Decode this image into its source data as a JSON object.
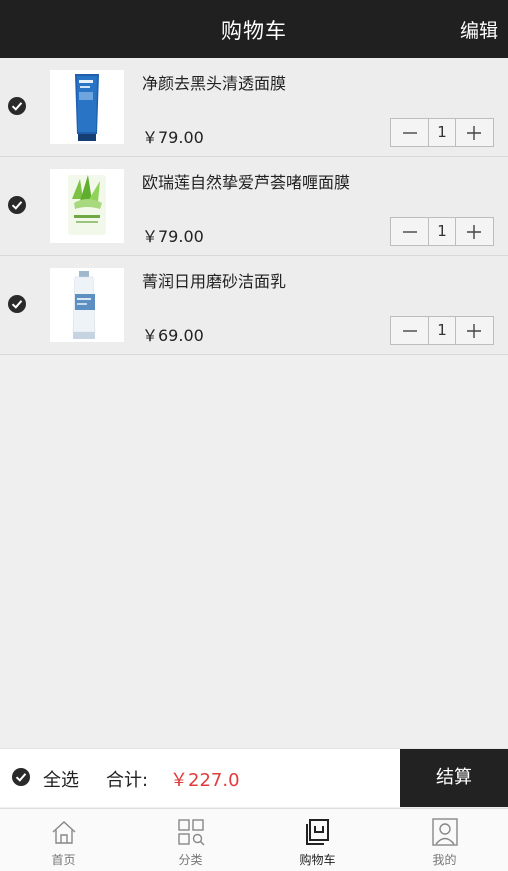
{
  "header": {
    "title": "购物车",
    "edit_label": "编辑"
  },
  "cart": {
    "items": [
      {
        "name": "净颜去黑头清透面膜",
        "price": "￥79.00",
        "quantity": "1",
        "checked": true,
        "thumbnail": "blue-tube-product"
      },
      {
        "name": "欧瑞莲自然挚爱芦荟啫喱面膜",
        "price": "￥79.00",
        "quantity": "1",
        "checked": true,
        "thumbnail": "aloe-gel-product"
      },
      {
        "name": "菁润日用磨砂洁面乳",
        "price": "￥69.00",
        "quantity": "1",
        "checked": true,
        "thumbnail": "white-blue-tube-product"
      }
    ]
  },
  "settle": {
    "select_all_label": "全选",
    "total_label": "合计:",
    "total_value": "￥227.0",
    "checkout_label": "结算",
    "total_color": "#e23b3b"
  },
  "tabbar": {
    "tabs": [
      {
        "label": "首页",
        "icon": "home-icon",
        "active": false
      },
      {
        "label": "分类",
        "icon": "category-icon",
        "active": false
      },
      {
        "label": "购物车",
        "icon": "cart-icon",
        "active": true
      },
      {
        "label": "我的",
        "icon": "profile-icon",
        "active": false
      }
    ]
  },
  "colors": {
    "header_bg": "#202020",
    "checkout_bg": "#222222",
    "page_bg": "#efefef"
  }
}
